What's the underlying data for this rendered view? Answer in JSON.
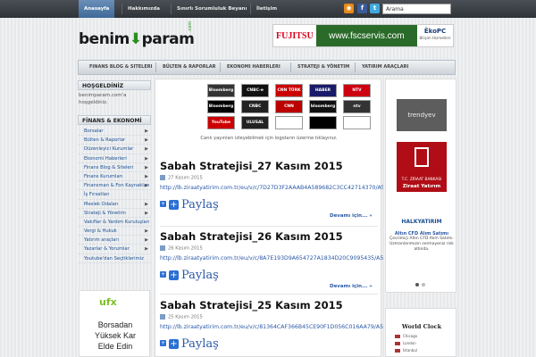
{
  "topnav": {
    "items": [
      "Anasayfa",
      "Hakkımızda",
      "Sınırlı Sorumluluk Beyanı",
      "İletişim"
    ],
    "search_value": "Arama"
  },
  "logo": {
    "part1": "benim",
    "part2": "param",
    "dom": ".com"
  },
  "banner": {
    "brand1": "FUJITSU",
    "url": "www.fscservis.com",
    "brand2": "ĒkoPC",
    "brand2_sub": "Bilişim Hizmetleri"
  },
  "catnav": [
    "Finans Blog & Siteleri",
    "Bülten & Raporlar",
    "Ekonomi Haberleri",
    "Strateji & Yönetim",
    "Yatırım Araçları"
  ],
  "sidebar": {
    "welcome_title": "HOŞGELDİNİZ",
    "welcome_text": "benimparam.com'a hoşgeldiniz.",
    "menu_title": "FİNANS & EKONOMİ",
    "menu": [
      {
        "label": "Borsalar",
        "arrow": true
      },
      {
        "label": "Bülten & Raporlar",
        "arrow": true
      },
      {
        "label": "Düzenleyici Kurumlar",
        "arrow": true
      },
      {
        "label": "Ekonomi Haberleri",
        "arrow": true
      },
      {
        "label": "Finans Blog & Siteleri",
        "arrow": true
      },
      {
        "label": "Finans Kurumları",
        "arrow": true
      },
      {
        "label": "Finansman & Fon Kaynakları",
        "arrow": true
      },
      {
        "label": "İş Fırsatları",
        "arrow": false
      },
      {
        "label": "Meslek Odaları",
        "arrow": true
      },
      {
        "label": "Strateji & Yönetim",
        "arrow": true
      },
      {
        "label": "Vakıflar & Yardım Kuruluşları",
        "arrow": false
      },
      {
        "label": "Vergi & Hukuk",
        "arrow": true
      },
      {
        "label": "Yatırım araçları",
        "arrow": true
      },
      {
        "label": "Yazarlar & Yorumlar",
        "arrow": true
      },
      {
        "label": "Youtube'dan Seçtiklerimiz",
        "arrow": false
      }
    ],
    "ad": {
      "logo_a": "ufx",
      "logo_b": "",
      "line1": "Borsadan",
      "line2": "Yüksek Kar",
      "line3": "Elde Edin"
    }
  },
  "channels": {
    "row1": [
      "Bloomberg",
      "CNBC-e",
      "CNN TÜRK",
      "HABER",
      "NTV"
    ],
    "row2": [
      "Bloomberg",
      "CNBC",
      "CNN",
      "bloomberg",
      "ntv"
    ],
    "row3": [
      "YouTube",
      "ULUSAL",
      "",
      "",
      ""
    ],
    "caption": "Canlı yayınları izleyebilmek için logoların üzerine tıklayınız."
  },
  "posts": [
    {
      "title": "Sabah Stratejisi_27 Kasım 2015",
      "date": "27 Kasım 2015",
      "link": "http://lb.ziraatyatirim.com.tr/eu/v/c/7D27D3F2AAAB4A589682C3CC42714370/A5",
      "share": "Paylaş",
      "more": "Devamı için... »"
    },
    {
      "title": "Sabah Stratejisi_26 Kasım 2015",
      "date": "26 Kasım 2015",
      "link": "http://lb.ziraatyatirim.com.tr/eu/v/c/8A7E193D9A654727A1834D20C9095435/A5",
      "share": "Paylaş",
      "more": "Devamı için... »"
    },
    {
      "title": "Sabah Stratejisi_25 Kasım 2015",
      "date": "25 Kasım 2015",
      "link": "http://lb.ziraatyatirim.com.tr/eu/v/c/81364CAF366B45CE90F1D056C016AA79/A5",
      "share": "Paylaş",
      "more": ""
    }
  ],
  "right": {
    "trendyev": "trendyev",
    "ziraat": "T.C. ZİRAAT BANKASI",
    "ziraat_sub": "Ziraat Yatırım",
    "halk": "HALKYATIRIM",
    "altin_title": "Altın CFD Alım Satımı",
    "altin_text": "Çevrimiçi Altın CFD Alım Satımı. Uzmanlarımızın sermayeniz risk altında."
  },
  "clock": {
    "title": "World Clock",
    "cities": [
      "Chicago",
      "London",
      "İstanbul"
    ]
  }
}
